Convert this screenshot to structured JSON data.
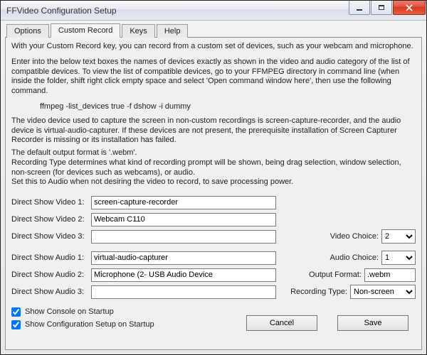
{
  "window": {
    "title": "FFVideo Configuration Setup"
  },
  "tabs": {
    "options": "Options",
    "custom_record": "Custom Record",
    "keys": "Keys",
    "help": "Help"
  },
  "text": {
    "p1": "With your Custom Record key, you can record from a custom set of devices, such as your webcam and microphone.",
    "p2": "Enter into the below text boxes the names of devices exactly as shown in the video and audio category of the list of compatible devices. To view the list of compatible devices, go to your FFMPEG directory in command line (when inside the folder, shift right click empty space and select 'Open command window here', then use the following command.",
    "cmd": "ffmpeg -list_devices true -f dshow -i dummy",
    "p3": "The video device used to capture the screen in non-custom recordings is screen-capture-recorder, and the audio device is virtual-audio-capturer. If these devices are not present, the prerequisite installation of Screen Capturer Recorder is missing or its installation has failed.",
    "p4": "The default output format is '.webm'.",
    "p5": "Recording Type determines what kind of recording prompt will be shown, being drag selection, window selection, non-screen (for devices such as webcams), or audio.",
    "p6": "Set this to Audio when not desiring the video to record, to save processing power."
  },
  "labels": {
    "dsv1": "Direct Show Video 1:",
    "dsv2": "Direct Show Video 2:",
    "dsv3": "Direct Show Video 3:",
    "dsa1": "Direct Show Audio 1:",
    "dsa2": "Direct Show Audio 2:",
    "dsa3": "Direct Show Audio 3:",
    "video_choice": "Video Choice:",
    "audio_choice": "Audio Choice:",
    "output_format": "Output Format:",
    "recording_type": "Recording Type:",
    "show_console": "Show Console on Startup",
    "show_config": "Show Configuration Setup on Startup"
  },
  "values": {
    "dsv1": "screen-capture-recorder",
    "dsv2": "Webcam C110",
    "dsv3": "",
    "dsa1": "virtual-audio-capturer",
    "dsa2": "Microphone (2- USB Audio Device",
    "dsa3": "",
    "video_choice": "2",
    "audio_choice": "1",
    "output_format": ".webm",
    "recording_type": "Non-screen",
    "show_console_checked": true,
    "show_config_checked": true
  },
  "buttons": {
    "cancel": "Cancel",
    "save": "Save"
  }
}
